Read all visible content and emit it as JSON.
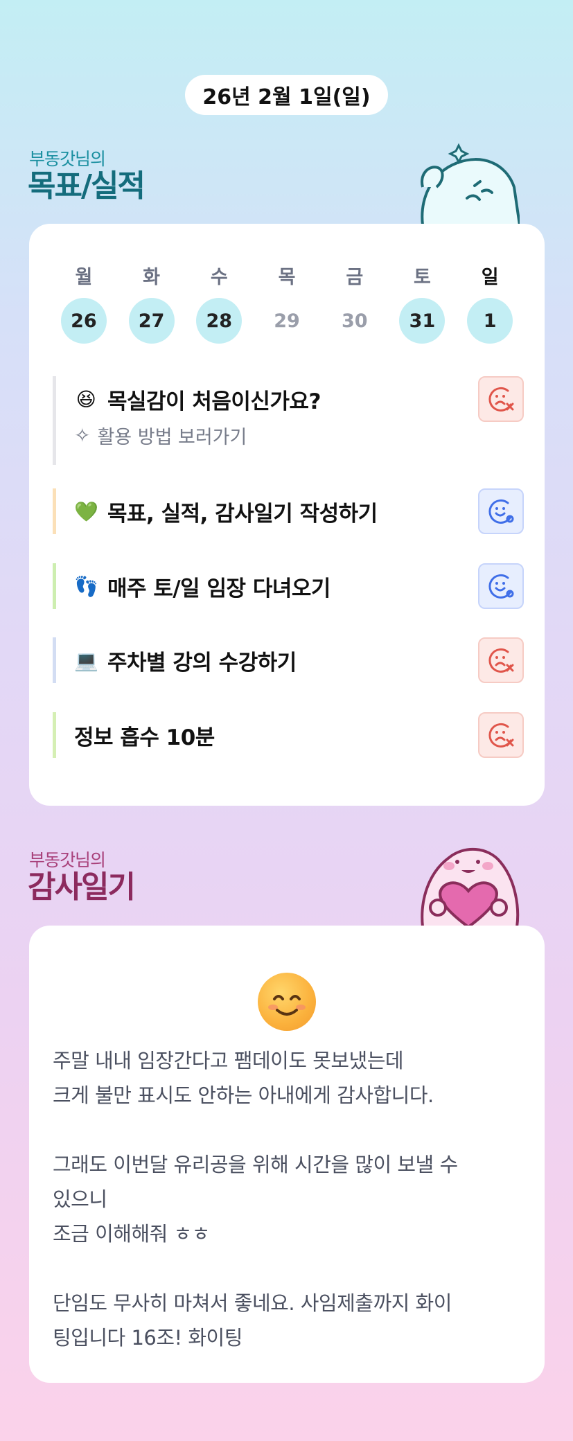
{
  "header": {
    "date": "26년 2월 1일(일)"
  },
  "goals_section": {
    "subtitle": "부동갓님의",
    "title": "목표/실적"
  },
  "calendar": {
    "weekdays": [
      "월",
      "화",
      "수",
      "목",
      "금",
      "토",
      "일"
    ],
    "days": [
      {
        "num": "26",
        "active": true
      },
      {
        "num": "27",
        "active": true
      },
      {
        "num": "28",
        "active": true
      },
      {
        "num": "29",
        "active": false
      },
      {
        "num": "30",
        "active": false
      },
      {
        "num": "31",
        "active": true
      },
      {
        "num": "1",
        "active": true
      }
    ]
  },
  "goals": [
    {
      "emoji": "😆",
      "title": "목실감이 처음이신가요?",
      "help": "활용 방법 보러가기",
      "status": "fail",
      "bar_color": "#e6e6ea"
    },
    {
      "emoji": "💚",
      "title": "목표, 실적, 감사일기 작성하기",
      "status": "ok",
      "bar_color": "#fbe0b8"
    },
    {
      "emoji": "👣",
      "title": "매주 토/일 임장 다녀오기",
      "status": "ok",
      "bar_color": "#cdeeb0"
    },
    {
      "emoji": "💻",
      "title": "주차별 강의 수강하기",
      "status": "fail",
      "bar_color": "#d3ddf3"
    },
    {
      "emoji": "",
      "title": "정보 흡수 10분",
      "status": "fail",
      "bar_color": "#d5efb4"
    }
  ],
  "diary_section": {
    "subtitle": "부동갓님의",
    "title": "감사일기"
  },
  "diary": {
    "text": "주말 내내 임장간다고 팸데이도 못보냈는데\n크게 불만 표시도 안하는 아내에게 감사합니다.\n\n그래도 이번달 유리공을 위해 시간을 많이 보낼 수\n있으니\n조금 이해해줘 ㅎㅎ\n\n단임도 무사히 마쳐서 좋네요. 사임제출까지 화이\n팅입니다 16조! 화이팅"
  },
  "colors": {
    "teal_title": "#146c7c",
    "pink_title": "#8c2a5e",
    "active_day": "#c3eef4",
    "fail_icon": "#e0554a",
    "ok_icon": "#3f6ee8"
  }
}
